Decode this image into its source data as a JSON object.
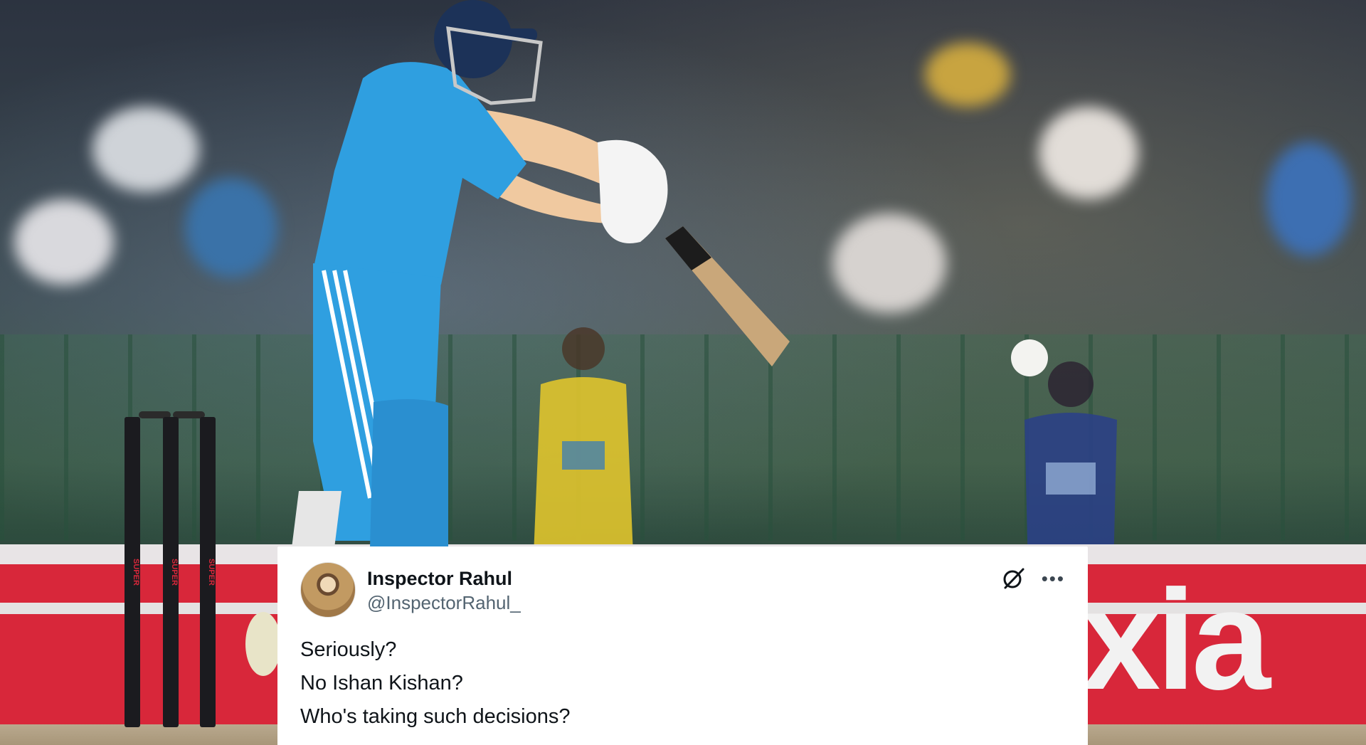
{
  "scene": {
    "stump_label": "SUPER"
  },
  "tweet": {
    "author_name": "Inspector Rahul",
    "author_handle": "@InspectorRahul_",
    "icons": [
      "grok-icon",
      "more-options-icon"
    ],
    "more_glyph": "•••",
    "lines": [
      "Seriously?",
      "No Ishan Kishan?",
      "Who's taking such decisions?"
    ]
  },
  "colors": {
    "jersey": "#2f9fe0",
    "board_red": "#d8273a",
    "tweet_bg": "#ffffff",
    "handle_gray": "#536471"
  }
}
